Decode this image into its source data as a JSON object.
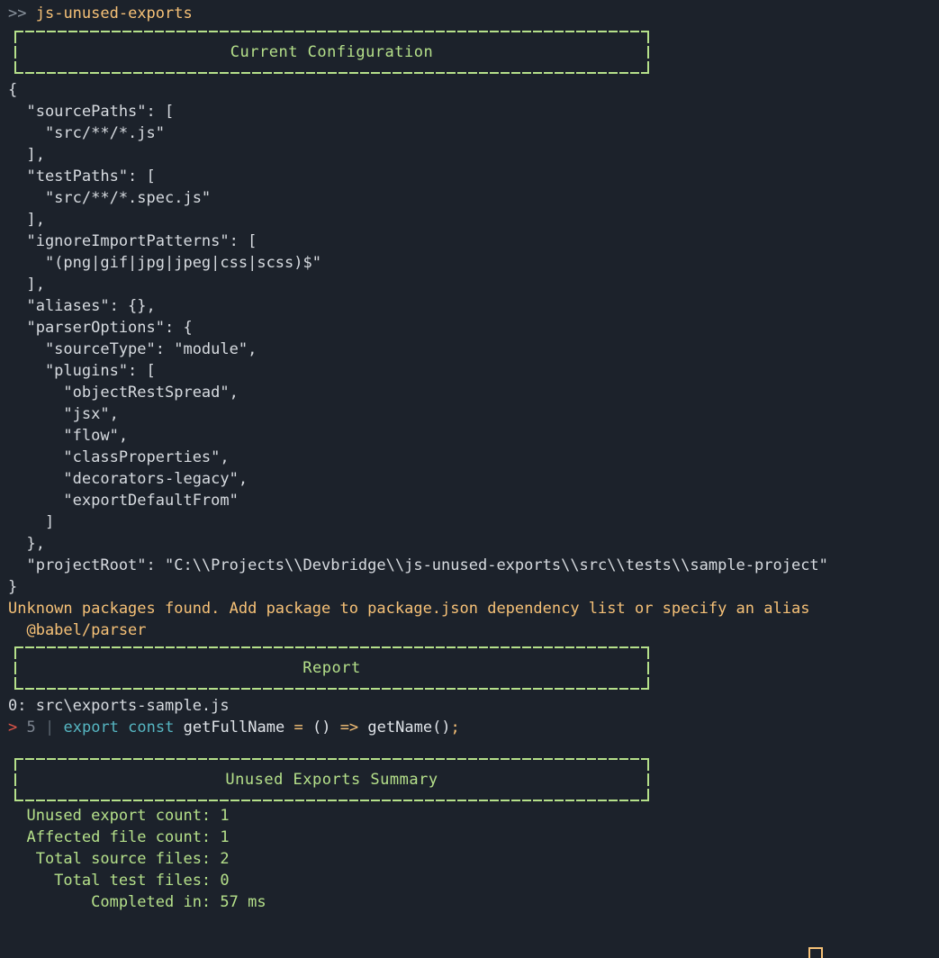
{
  "terminal": {
    "background_color": "#1c222b",
    "foreground_color": "#d7dbe0",
    "accent_green": "#b5e08a",
    "accent_orange": "#f6c177",
    "accent_cyan": "#56b6c2",
    "accent_red": "#e45649"
  },
  "prompt": {
    "symbol": ">>",
    "command": "js-unused-exports"
  },
  "banners": {
    "config": "Current Configuration",
    "report": "Report",
    "summary": "Unused Exports Summary"
  },
  "config_json": [
    "{",
    "  \"sourcePaths\": [",
    "    \"src/**/*.js\"",
    "  ],",
    "  \"testPaths\": [",
    "    \"src/**/*.spec.js\"",
    "  ],",
    "  \"ignoreImportPatterns\": [",
    "    \"(png|gif|jpg|jpeg|css|scss)$\"",
    "  ],",
    "  \"aliases\": {},",
    "  \"parserOptions\": {",
    "    \"sourceType\": \"module\",",
    "    \"plugins\": [",
    "      \"objectRestSpread\",",
    "      \"jsx\",",
    "      \"flow\",",
    "      \"classProperties\",",
    "      \"decorators-legacy\",",
    "      \"exportDefaultFrom\"",
    "    ]",
    "  },",
    "  \"projectRoot\": \"C:\\\\Projects\\\\Devbridge\\\\js-unused-exports\\\\src\\\\tests\\\\sample-project\"",
    "}"
  ],
  "warning": {
    "message": "Unknown packages found. Add package to package.json dependency list or specify an alias",
    "packages": [
      "  @babel/parser"
    ]
  },
  "report": {
    "file_entry": "0: src\\exports-sample.js",
    "code": {
      "marker": ">",
      "line_number": "5",
      "gutter": "|",
      "keyword1": "export",
      "keyword2": "const",
      "identifier": "getFullName",
      "assign": "=",
      "params": "()",
      "arrow": "=>",
      "call": "getName()",
      "semicolon": ";"
    }
  },
  "summary": {
    "rows": [
      {
        "label": "  Unused export count:",
        "value": "1"
      },
      {
        "label": "  Affected file count:",
        "value": "1"
      },
      {
        "label": "   Total source files:",
        "value": "2"
      },
      {
        "label": "     Total test files:",
        "value": "0"
      },
      {
        "label": "         Completed in:",
        "value": "57 ms"
      }
    ]
  }
}
